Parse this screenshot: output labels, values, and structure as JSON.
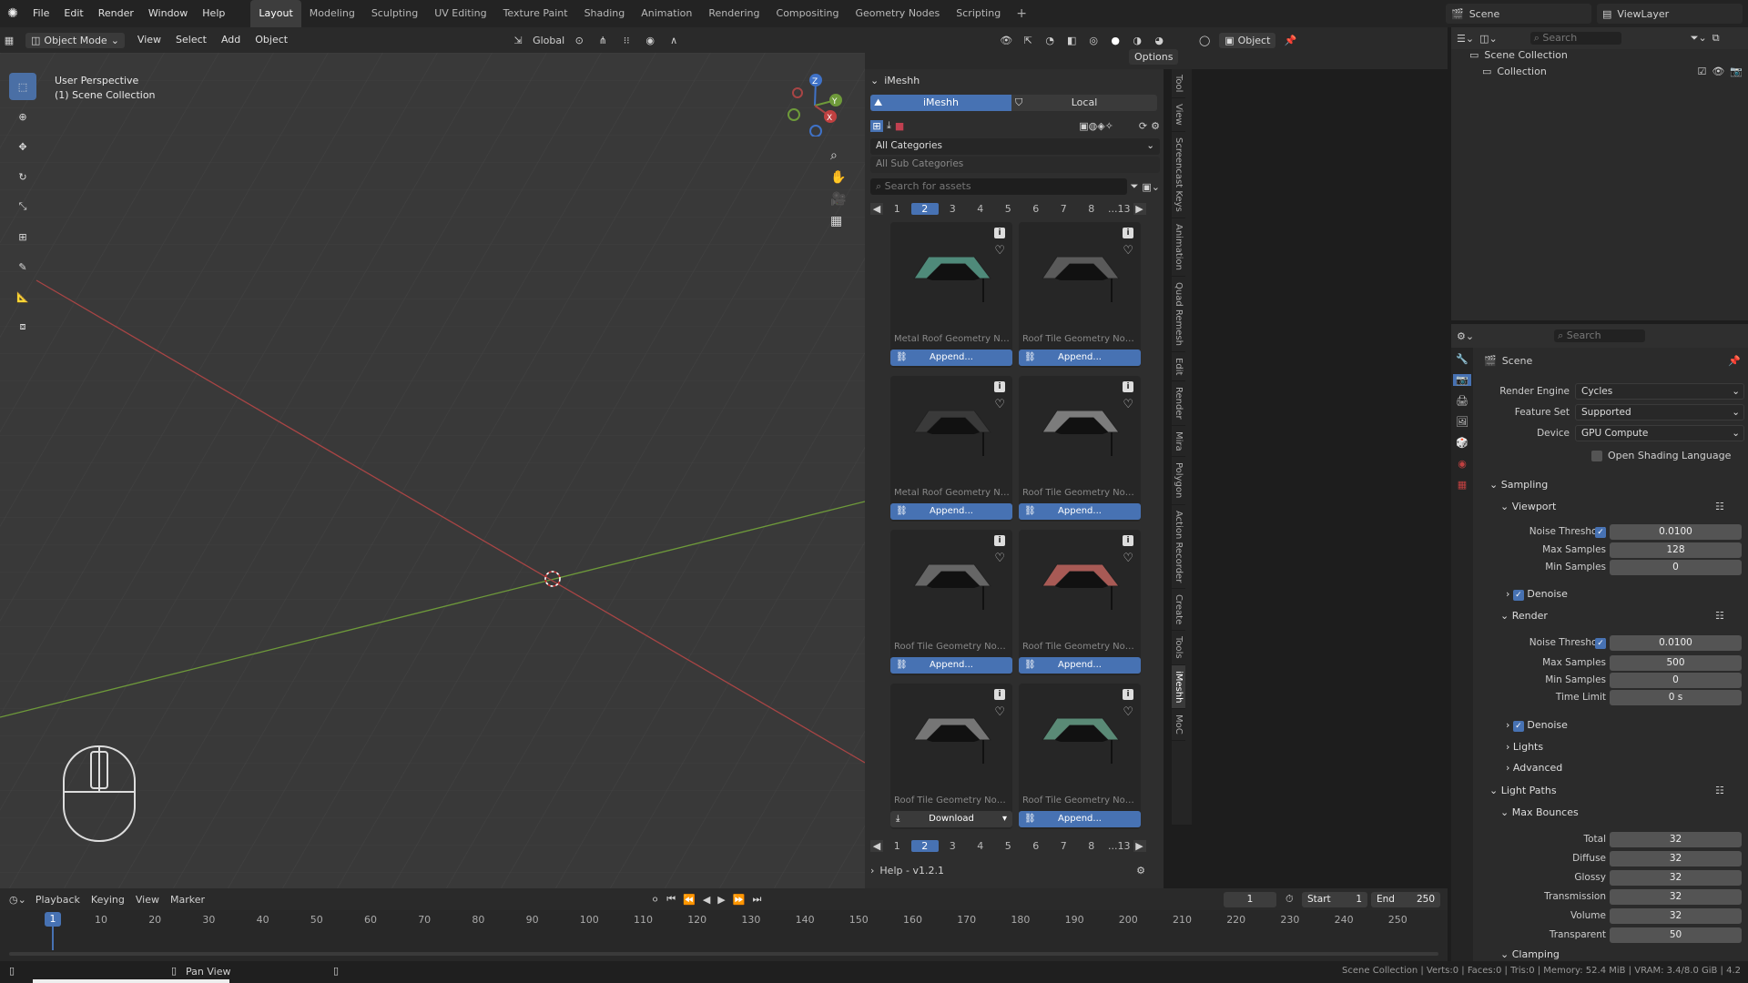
{
  "menubar": {
    "menus": [
      "File",
      "Edit",
      "Render",
      "Window",
      "Help"
    ],
    "workspaces": [
      "Layout",
      "Modeling",
      "Sculpting",
      "UV Editing",
      "Texture Paint",
      "Shading",
      "Animation",
      "Rendering",
      "Compositing",
      "Geometry Nodes",
      "Scripting"
    ],
    "active_workspace": "Layout",
    "add_tab": "+",
    "scene_name": "Scene",
    "view_layer": "ViewLayer"
  },
  "viewport_header": {
    "mode": "Object Mode",
    "menus": [
      "View",
      "Select",
      "Add",
      "Object"
    ],
    "orientation": "Global",
    "options_label": "Options",
    "perspective_label": "User Perspective",
    "collection_label": "(1) Scene Collection"
  },
  "imeshh": {
    "panel_title": "iMeshh",
    "tab_main": "iMeshh",
    "tab_local": "Local",
    "category": "All Categories",
    "sub_category": "All Sub Categories",
    "search_placeholder": "Search for assets",
    "pages": [
      "1",
      "2",
      "3",
      "4",
      "5",
      "6",
      "7",
      "8",
      "...13"
    ],
    "active_page": "2",
    "assets": [
      {
        "title": "Metal Roof Geometry No...",
        "action": "Append...",
        "roof_color": "#4f8a7a"
      },
      {
        "title": "Roof Tile Geometry Node...",
        "action": "Append...",
        "roof_color": "#5a5a5a"
      },
      {
        "title": "Metal Roof Geometry No...",
        "action": "Append...",
        "roof_color": "#3a3a3a"
      },
      {
        "title": "Roof Tile Geometry Node...",
        "action": "Append...",
        "roof_color": "#7c7c7c"
      },
      {
        "title": "Roof Tile Geometry Node...",
        "action": "Append...",
        "roof_color": "#666666"
      },
      {
        "title": "Roof Tile Geometry Node...",
        "action": "Append...",
        "roof_color": "#a85a55"
      },
      {
        "title": "Roof Tile Geometry Node...",
        "action": "Download",
        "roof_color": "#767676"
      },
      {
        "title": "Roof Tile Geometry Node...",
        "action": "Append...",
        "roof_color": "#5a8a76"
      }
    ],
    "help_label": "Help - v1.2.1"
  },
  "side_tabs": [
    "Tool",
    "View",
    "Screencast Keys",
    "Animation",
    "Quad Remesh",
    "Edit",
    "Render",
    "Mira",
    "Polygon",
    "Action Recorder",
    "Create",
    "Tools",
    "iMeshh",
    "MoC"
  ],
  "outliner": {
    "search_placeholder": "Search",
    "items": [
      "Scene Collection",
      "Collection"
    ]
  },
  "properties": {
    "search_placeholder": "Search",
    "context": "Scene",
    "render_engine_label": "Render Engine",
    "render_engine": "Cycles",
    "feature_set_label": "Feature Set",
    "feature_set": "Supported",
    "device_label": "Device",
    "device": "GPU Compute",
    "osl_label": "Open Shading Language",
    "sampling": "Sampling",
    "viewport": "Viewport",
    "noise_threshold_label": "Noise Threshold",
    "vp_noise_threshold": "0.0100",
    "max_samples_label": "Max Samples",
    "vp_max_samples": "128",
    "min_samples_label": "Min Samples",
    "vp_min_samples": "0",
    "denoise": "Denoise",
    "render": "Render",
    "r_noise_threshold": "0.0100",
    "r_max_samples": "500",
    "r_min_samples": "0",
    "time_limit_label": "Time Limit",
    "time_limit": "0 s",
    "lights": "Lights",
    "advanced": "Advanced",
    "light_paths": "Light Paths",
    "max_bounces": "Max Bounces",
    "bounces": [
      {
        "label": "Total",
        "value": "32"
      },
      {
        "label": "Diffuse",
        "value": "32"
      },
      {
        "label": "Glossy",
        "value": "32"
      },
      {
        "label": "Transmission",
        "value": "32"
      },
      {
        "label": "Volume",
        "value": "32"
      },
      {
        "label": "Transparent",
        "value": "50"
      }
    ],
    "clamping": "Clamping"
  },
  "timeline": {
    "menus": [
      "Playback",
      "Keying",
      "View",
      "Marker"
    ],
    "current_frame": "1",
    "start_label": "Start",
    "start": "1",
    "end_label": "End",
    "end": "250",
    "ticks": [
      "10",
      "20",
      "30",
      "40",
      "50",
      "60",
      "70",
      "80",
      "90",
      "100",
      "110",
      "120",
      "130",
      "140",
      "150",
      "160",
      "170",
      "180",
      "190",
      "200",
      "210",
      "220",
      "230",
      "240",
      "250"
    ],
    "cursor_frame": "1"
  },
  "statusbar": {
    "hint": "Pan View",
    "stats": "Scene Collection | Verts:0 | Faces:0 | Tris:0 | Memory: 52.4 MiB | VRAM: 3.4/8.0 GiB | 4.2"
  },
  "colors": {
    "accent": "#4772b3",
    "x_axis": "#a84545",
    "y_axis": "#6e9a3a",
    "z_axis": "#3f72c8"
  }
}
